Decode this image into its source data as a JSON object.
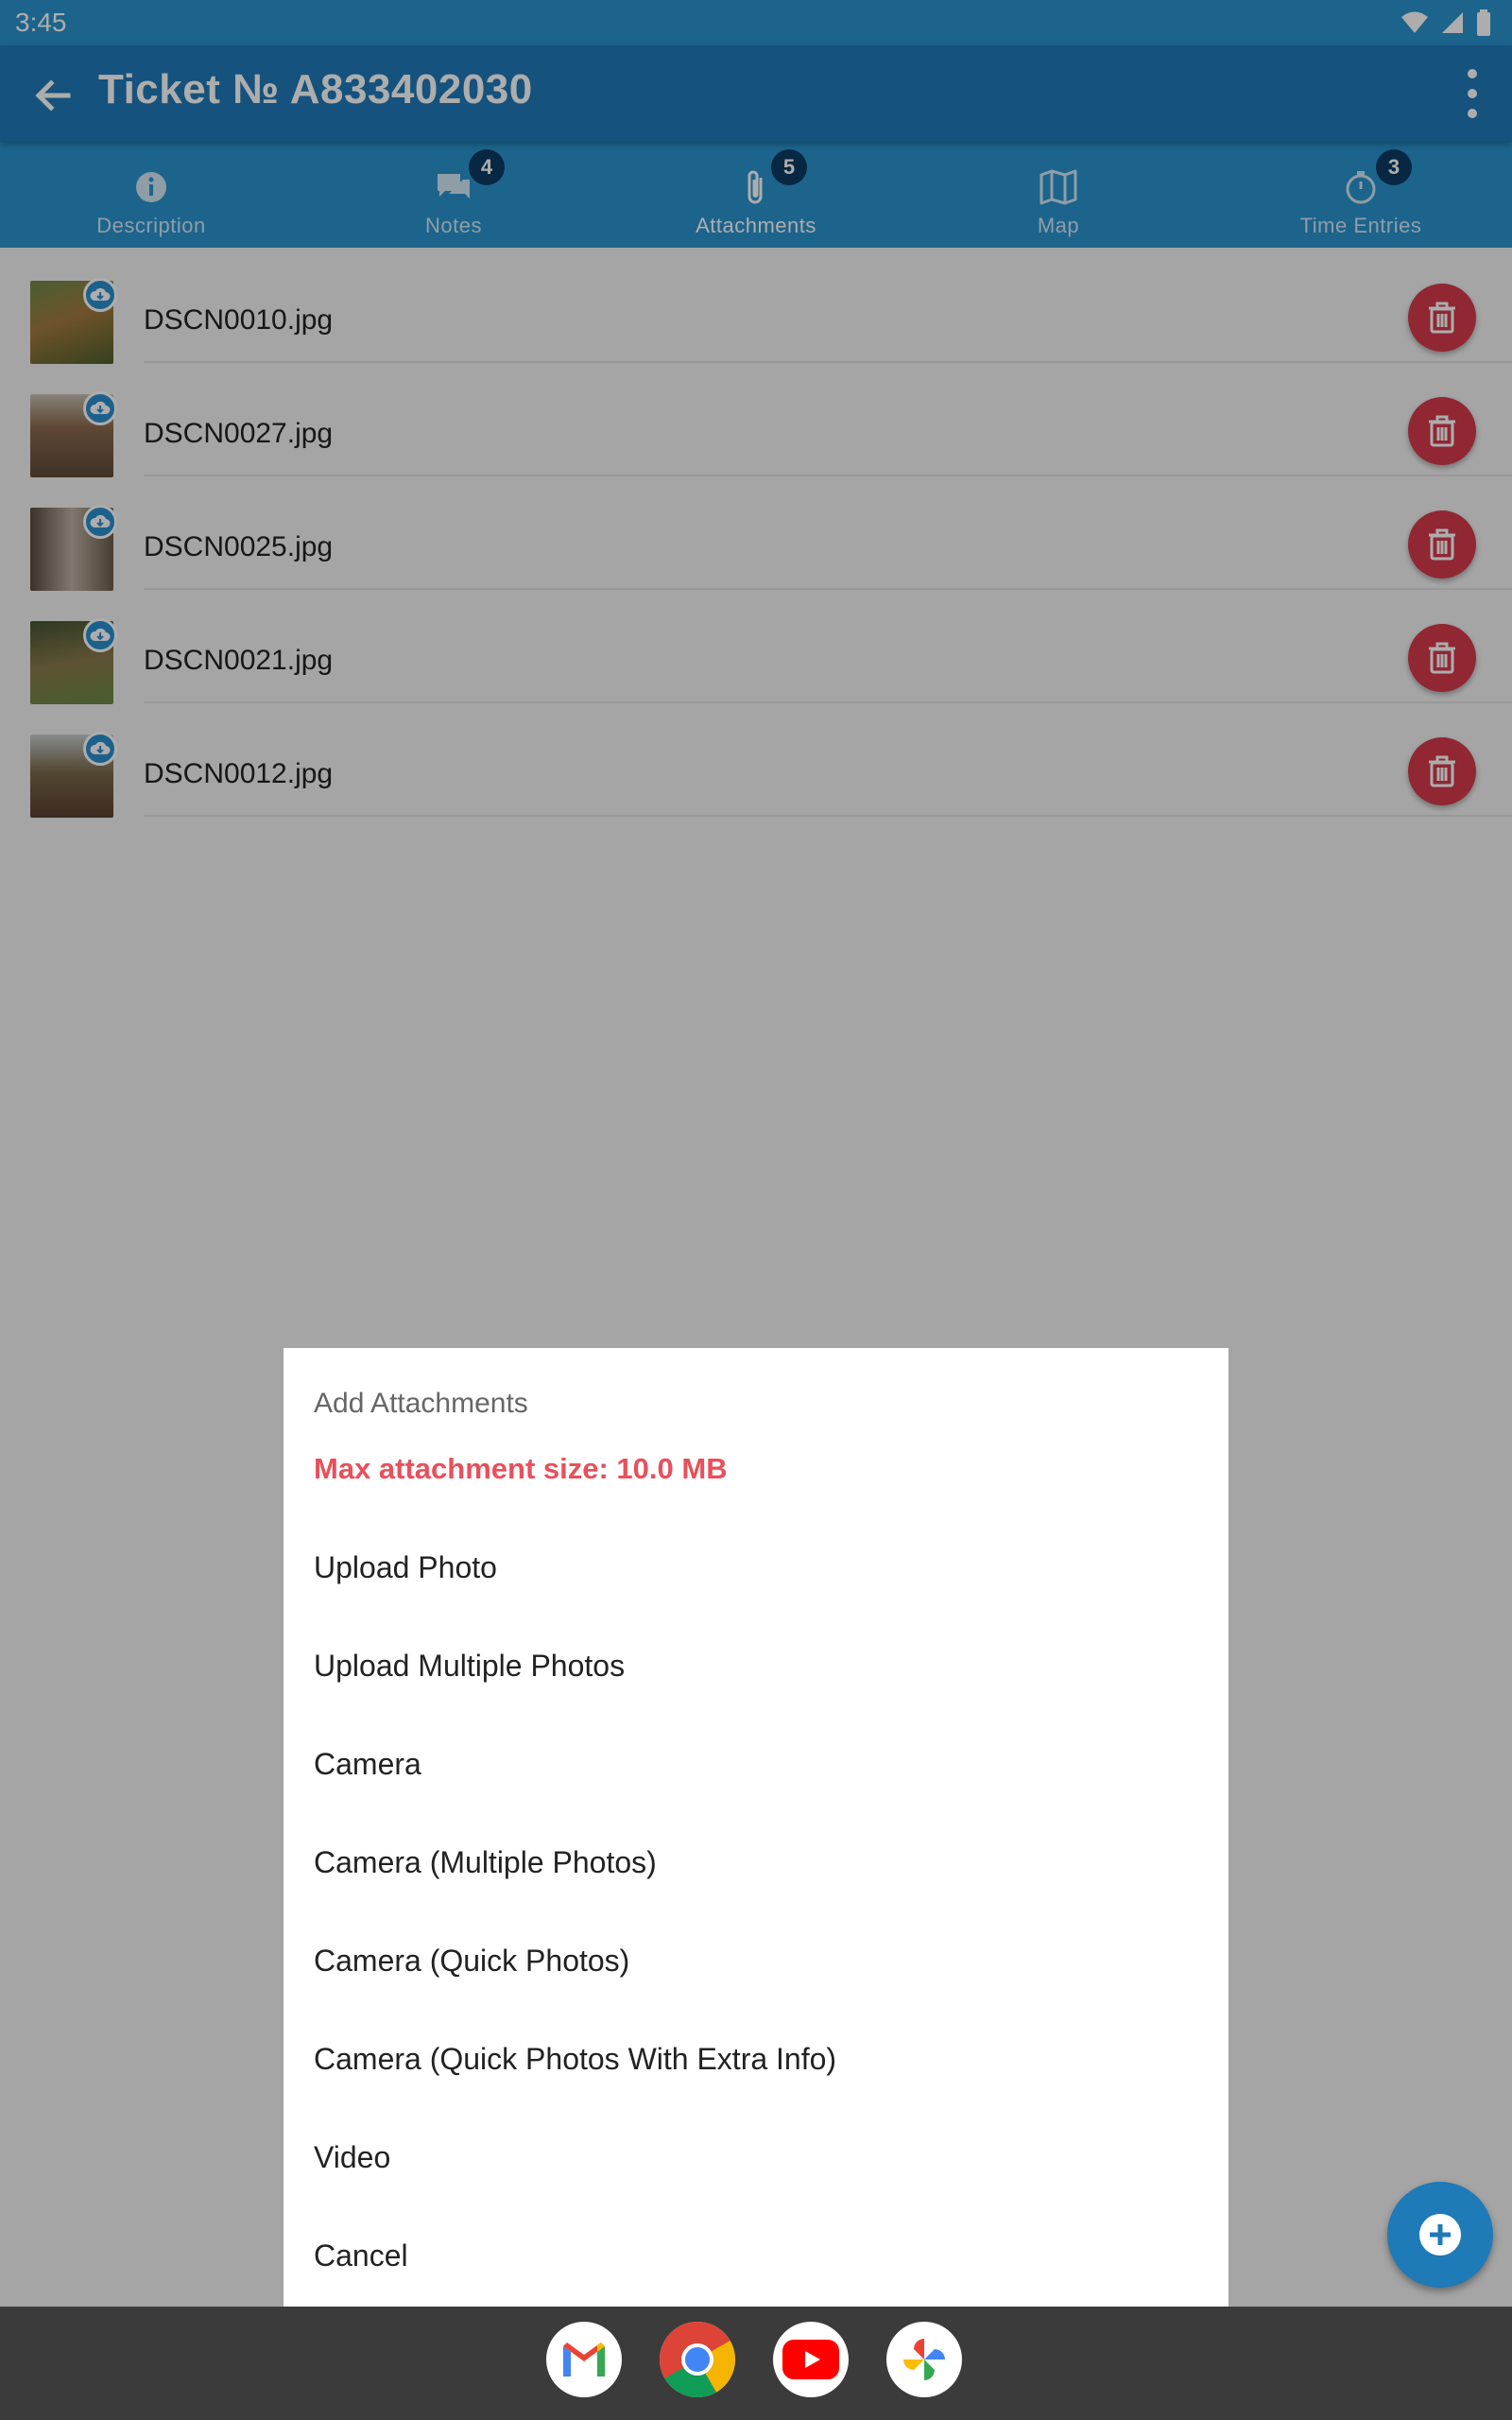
{
  "status_bar": {
    "time": "3:45"
  },
  "app_bar": {
    "title": "Ticket № A833402030"
  },
  "tabs": [
    {
      "label": "Description",
      "icon": "info-icon",
      "badge": ""
    },
    {
      "label": "Notes",
      "icon": "chat-icon",
      "badge": "4"
    },
    {
      "label": "Attachments",
      "icon": "paperclip-icon",
      "badge": "5"
    },
    {
      "label": "Map",
      "icon": "map-icon",
      "badge": ""
    },
    {
      "label": "Time Entries",
      "icon": "timer-icon",
      "badge": "3"
    }
  ],
  "active_tab": "Attachments",
  "attachments": [
    {
      "name": "DSCN0010.jpg"
    },
    {
      "name": "DSCN0027.jpg"
    },
    {
      "name": "DSCN0025.jpg"
    },
    {
      "name": "DSCN0021.jpg"
    },
    {
      "name": "DSCN0012.jpg"
    }
  ],
  "dialog": {
    "title": "Add Attachments",
    "warning": "Max attachment size: 10.0 MB",
    "options": [
      "Upload Photo",
      "Upload Multiple Photos",
      "Camera",
      "Camera (Multiple Photos)",
      "Camera (Quick Photos)",
      "Camera (Quick Photos With Extra Info)",
      "Video",
      "Cancel"
    ]
  },
  "dock_apps": [
    "Gmail",
    "Chrome",
    "YouTube",
    "Photos"
  ],
  "colors": {
    "primary": "#1f7ab8",
    "tab_bar": "#2a94cf",
    "delete": "#d43a4c",
    "warning": "#e8505b"
  }
}
